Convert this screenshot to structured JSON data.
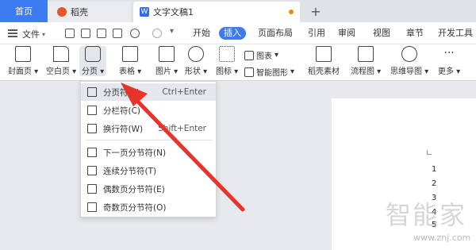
{
  "tabs": {
    "home": "首页",
    "docer": "稻壳",
    "doc": "文字文稿1",
    "add": "+"
  },
  "menubar": {
    "file": "文件",
    "items": [
      "开始",
      "插入",
      "页面布局",
      "引用",
      "审阅",
      "视图",
      "章节",
      "开发工具"
    ],
    "active_index": 1
  },
  "ribbon": {
    "cover_page": "封面页",
    "blank_page": "空白页",
    "page_break": "分页",
    "table": "表格",
    "picture": "图片",
    "shape": "形状",
    "icon": "图标",
    "chart": "图表",
    "smart_graphic": "智能图形",
    "docer_material": "稻壳素材",
    "flowchart": "流程图",
    "mindmap": "思维导图",
    "more": "更多"
  },
  "dropdown": {
    "items": [
      {
        "label": "分页符(P)",
        "shortcut": "Ctrl+Enter"
      },
      {
        "label": "分栏符(C)",
        "shortcut": ""
      },
      {
        "label": "换行符(W)",
        "shortcut": "Shift+Enter"
      },
      {
        "label": "下一页分节符(N)",
        "shortcut": ""
      },
      {
        "label": "连续分节符(T)",
        "shortcut": ""
      },
      {
        "label": "偶数页分节符(E)",
        "shortcut": ""
      },
      {
        "label": "奇数页分节符(O)",
        "shortcut": ""
      }
    ]
  },
  "document": {
    "line_numbers": [
      "1",
      "2",
      "3",
      "4",
      "5"
    ]
  },
  "watermark": {
    "text": "智能家",
    "url": "www.znj.com"
  },
  "colors": {
    "accent": "#3c7bf0",
    "arrow": "#e8332a"
  }
}
